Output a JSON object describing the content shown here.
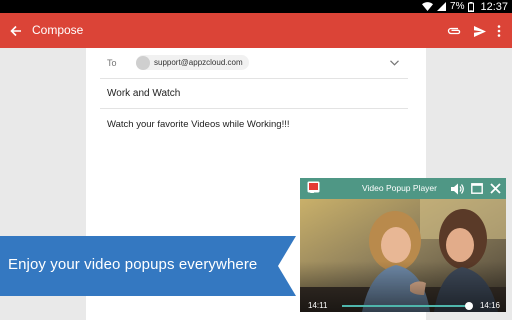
{
  "status_bar": {
    "battery": "7%",
    "time": "12:37"
  },
  "app_bar": {
    "title": "Compose",
    "color": "#db4437"
  },
  "compose": {
    "to_label": "To",
    "recipient": "support@appzcloud.com",
    "subject": "Work and Watch",
    "body": "Watch your favorite Videos while Working!!!"
  },
  "promo": {
    "text": "Enjoy your video popups everywhere",
    "color": "#3478c1"
  },
  "popup": {
    "title": "Video Popup Player",
    "current_time": "14:11",
    "total_time": "14:16",
    "progress": 0.99,
    "header_color": "#4f9785"
  }
}
